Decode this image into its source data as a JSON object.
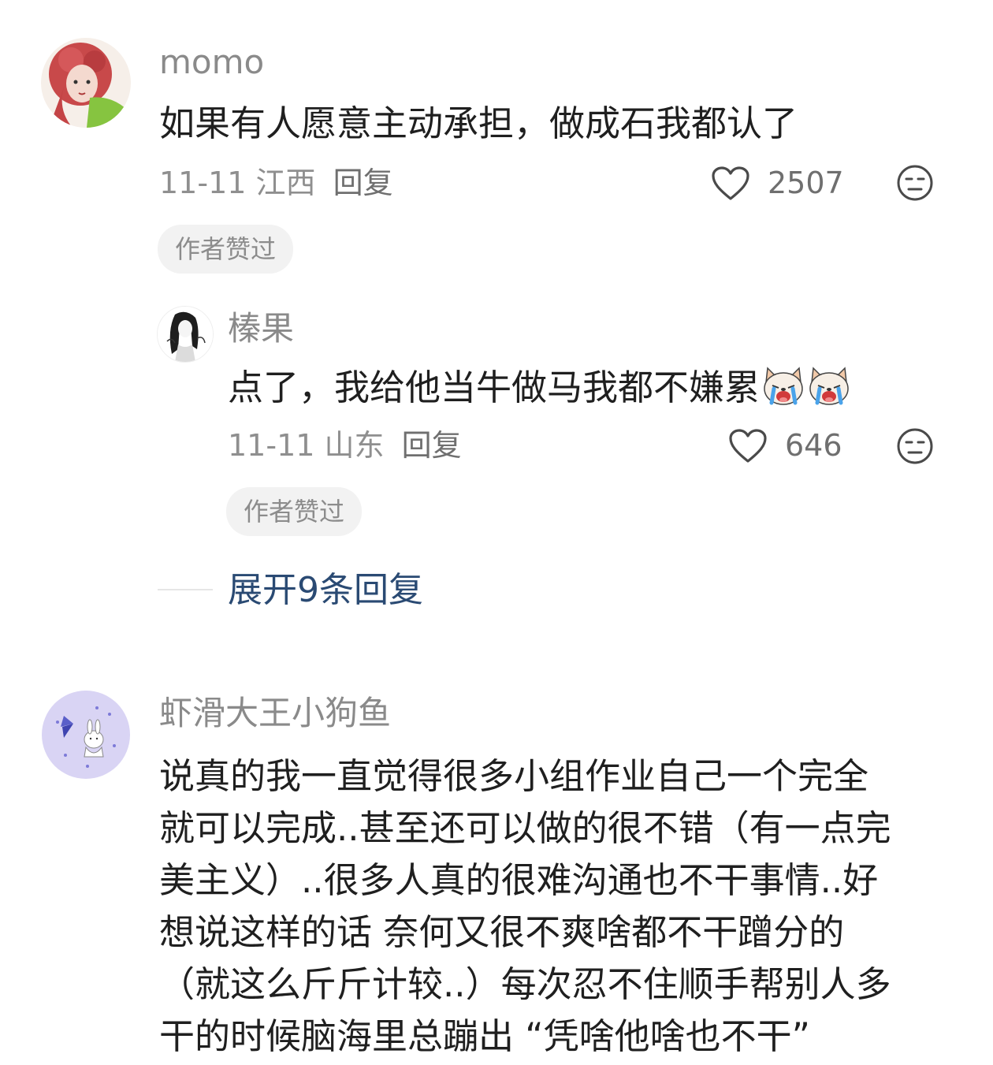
{
  "comments": [
    {
      "username": "momo",
      "text": "如果有人愿意主动承担，做成石我都认了",
      "date": "11-11",
      "location": "江西",
      "reply_label": "回复",
      "like_count": "2507",
      "badge": "作者赞过",
      "replies": [
        {
          "username": "榛果",
          "text": "点了，我给他当牛做马我都不嫌累",
          "emojis": [
            "crying-dog-emoji",
            "crying-dog-emoji"
          ],
          "date": "11-11",
          "location": "山东",
          "reply_label": "回复",
          "like_count": "646",
          "badge": "作者赞过"
        }
      ],
      "expand_label": "展开9条回复"
    },
    {
      "username": "虾滑大王小狗鱼",
      "text_lines": [
        "说真的我一直觉得很多小组作业自己一个完全",
        "就可以完成..甚至还可以做的很不错（有一点完",
        "美主义）..很多人真的很难沟通也不干事情..好",
        "想说这样的话 奈何又很不爽啥都不干蹭分的",
        "（就这么斤斤计较..）每次忍不住顺手帮别人多",
        "干的时候脑海里总蹦出 “凭啥他啥也不干”"
      ]
    }
  ],
  "icons": {
    "like": "heart-outline-icon",
    "dislike": "meh-face-icon"
  },
  "colors": {
    "username": "#8a8a8a",
    "text": "#1f1f1f",
    "expand_link": "#2a4a73",
    "badge_bg": "#f2f2f2"
  }
}
